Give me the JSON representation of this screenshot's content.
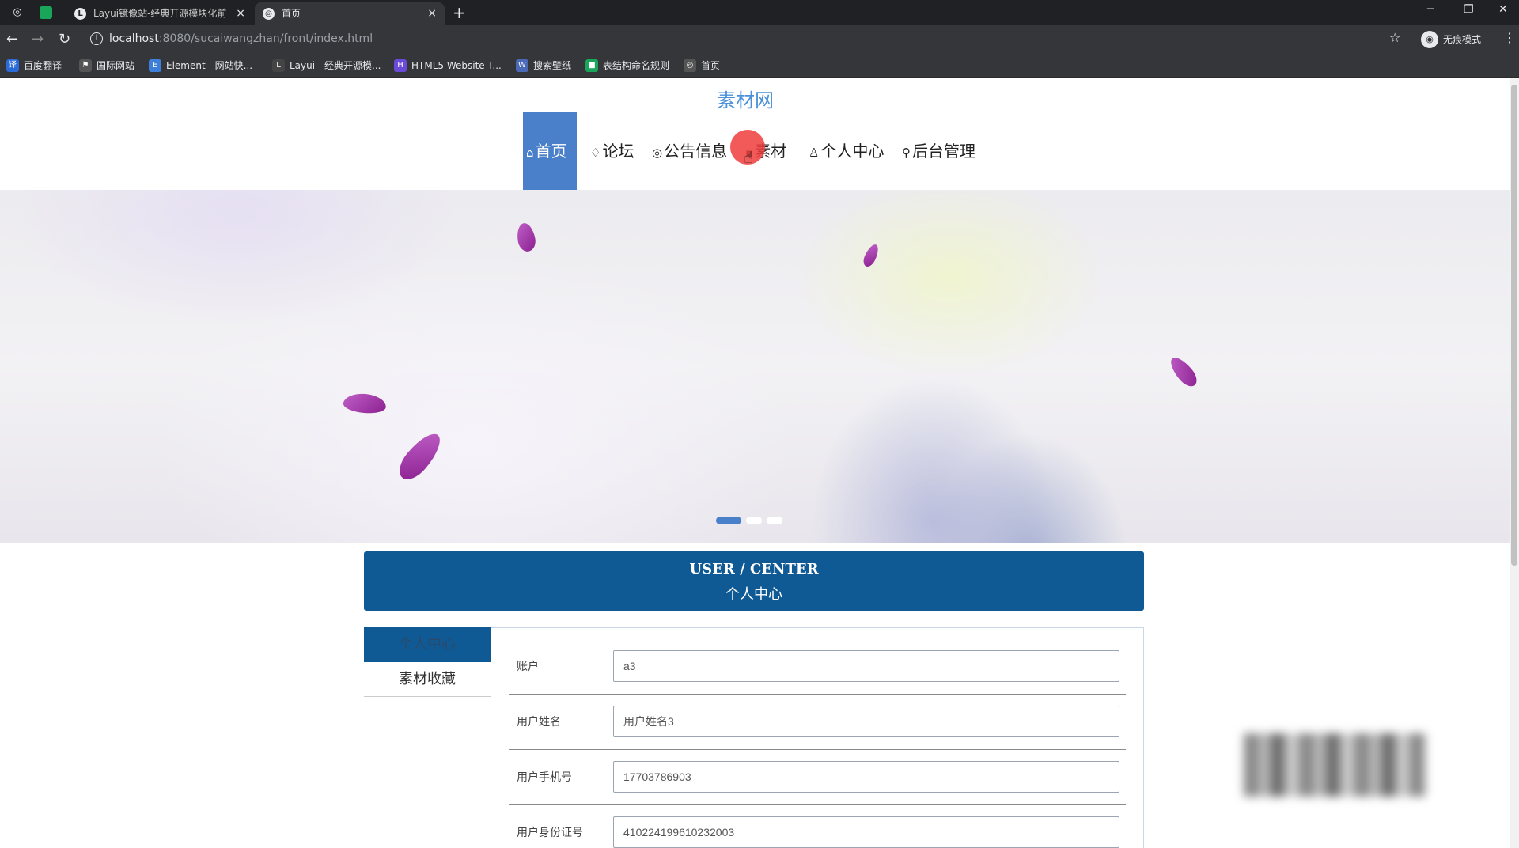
{
  "browser": {
    "tabs": [
      {
        "title": "Layui镜像站-经典开源模块化前",
        "favicon": "L"
      },
      {
        "title": "首页",
        "favicon": "◎"
      }
    ],
    "url_host": "localhost",
    "url_path": ":8080/sucaiwangzhan/front/index.html",
    "incognito_label": "无痕模式",
    "bookmarks": [
      {
        "label": "百度翻译",
        "color": "#2a6ad9",
        "icon": "译"
      },
      {
        "label": "国际网站",
        "color": "#555555",
        "icon": "⚑"
      },
      {
        "label": "Element - 网站快...",
        "color": "#3d7fd9",
        "icon": "E"
      },
      {
        "label": "Layui - 经典开源模...",
        "color": "#444444",
        "icon": "L"
      },
      {
        "label": "HTML5 Website T...",
        "color": "#6a4bd9",
        "icon": "H"
      },
      {
        "label": "搜索壁纸",
        "color": "#4a6ab8",
        "icon": "W"
      },
      {
        "label": "表结构命名规则",
        "color": "#1aa65a",
        "icon": "■"
      },
      {
        "label": "首页",
        "color": "#555555",
        "icon": "◎"
      }
    ]
  },
  "site": {
    "title": "素材网",
    "nav": [
      {
        "label": "首页",
        "icon": "⌂"
      },
      {
        "label": "论坛",
        "icon": "♢"
      },
      {
        "label": "公告信息",
        "icon": "◎"
      },
      {
        "label": "素材",
        "icon": "▪"
      },
      {
        "label": "个人中心",
        "icon": "♙"
      },
      {
        "label": "后台管理",
        "icon": "⚲"
      }
    ],
    "carousel": {
      "slide_count": 3,
      "active_index": 0
    }
  },
  "user_center": {
    "title_en": "USER / CENTER",
    "title_cn": "个人中心",
    "side_menu": [
      {
        "label": "个人中心",
        "active": true
      },
      {
        "label": "素材收藏",
        "active": false
      }
    ],
    "form": [
      {
        "label": "账户",
        "value": "a3"
      },
      {
        "label": "用户姓名",
        "value": "用户姓名3"
      },
      {
        "label": "用户手机号",
        "value": "17703786903"
      },
      {
        "label": "用户身份证号",
        "value": "410224199610232003"
      }
    ]
  },
  "colors": {
    "accent": "#4a7fc9",
    "header_blue": "#0f5a95",
    "title_blue": "#4a90d9"
  }
}
